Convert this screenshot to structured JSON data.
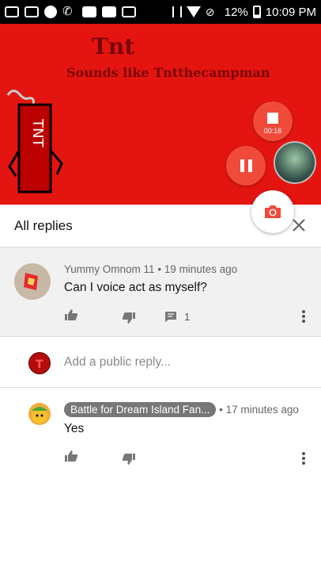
{
  "status_bar": {
    "battery": "12%",
    "time": "10:09 PM"
  },
  "video": {
    "title": "Tnt",
    "subtitle": "Sounds like Tntthecampman",
    "record_timer": "00:16"
  },
  "header": {
    "title": "All replies"
  },
  "comments": [
    {
      "author": "Yummy Omnom 11",
      "time": "19 minutes ago",
      "text": "Can I voice act as myself?",
      "reply_count": "1"
    },
    {
      "author": "Battle for Dream Island Fan...",
      "time": "17 minutes ago",
      "text": "Yes"
    }
  ],
  "reply_input": {
    "placeholder": "Add a public reply..."
  },
  "colors": {
    "video_bg": "#e41510",
    "record_button": "#f04a3a"
  }
}
